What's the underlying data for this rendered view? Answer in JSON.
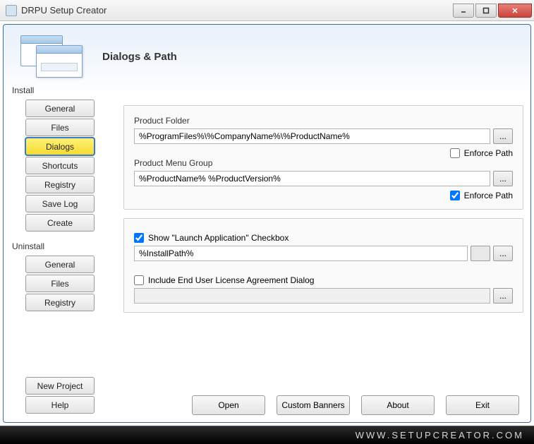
{
  "window": {
    "title": "DRPU Setup Creator"
  },
  "banner": {
    "title": "Dialogs & Path"
  },
  "sidebar": {
    "install": {
      "label": "Install",
      "items": [
        "General",
        "Files",
        "Dialogs",
        "Shortcuts",
        "Registry",
        "Save Log",
        "Create"
      ],
      "selected": 2
    },
    "uninstall": {
      "label": "Uninstall",
      "items": [
        "General",
        "Files",
        "Registry"
      ]
    },
    "bottom": [
      "New Project",
      "Help"
    ]
  },
  "dialogs": {
    "product_folder": {
      "label": "Product Folder",
      "value": "%ProgramFiles%\\%CompanyName%\\%ProductName%",
      "enforce": {
        "label": "Enforce Path",
        "checked": false
      }
    },
    "product_menu": {
      "label": "Product Menu Group",
      "value": "%ProductName% %ProductVersion%",
      "enforce": {
        "label": "Enforce Path",
        "checked": true
      }
    },
    "launch_app": {
      "label": "Show \"Launch Application\" Checkbox",
      "checked": true,
      "path": "%InstallPath%"
    },
    "eula": {
      "label": "Include End User License Agreement Dialog",
      "checked": false,
      "path": ""
    }
  },
  "actions": [
    "Open",
    "Custom Banners",
    "About",
    "Exit"
  ],
  "footer": "WWW.SETUPCREATOR.COM"
}
